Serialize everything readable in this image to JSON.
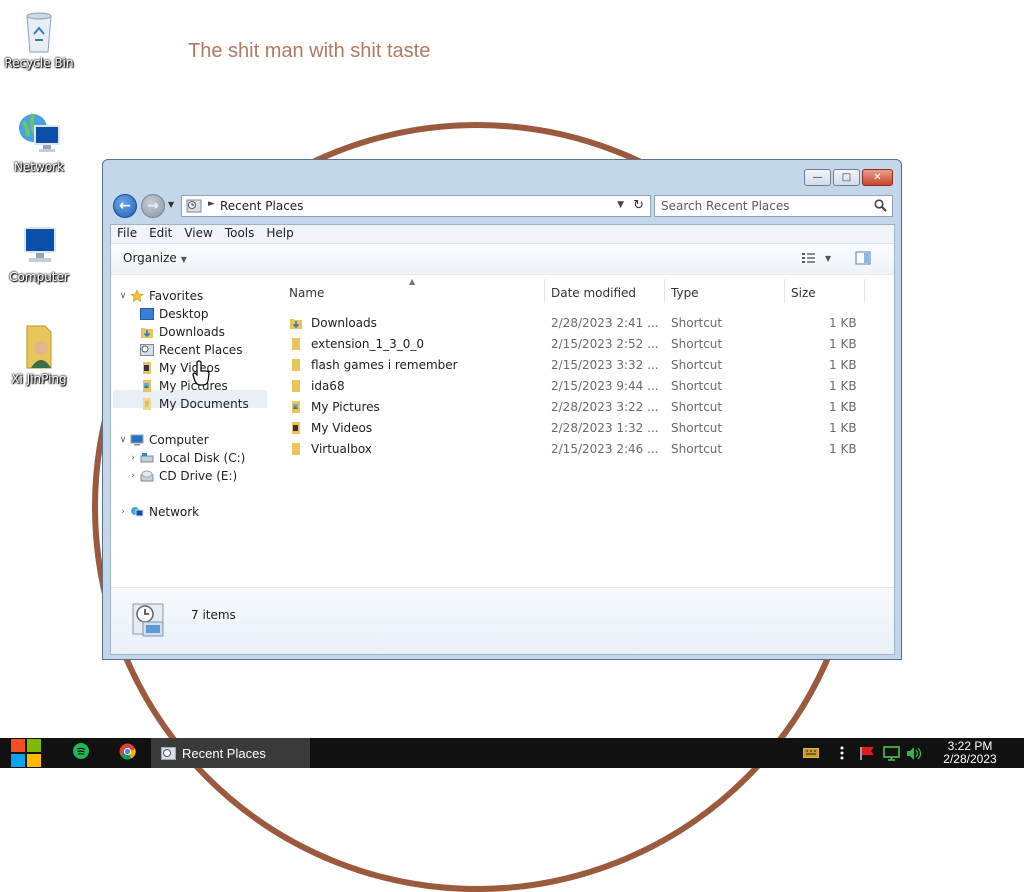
{
  "desktop": {
    "wallpaper_text": "The shit man with shit taste",
    "icons": [
      {
        "label": "Recycle Bin"
      },
      {
        "label": "Network"
      },
      {
        "label": "Computer"
      },
      {
        "label": "Xi JinPing"
      }
    ]
  },
  "window": {
    "address": {
      "path": "Recent Places"
    },
    "search": {
      "placeholder": "Search Recent Places"
    },
    "menu": [
      "File",
      "Edit",
      "View",
      "Tools",
      "Help"
    ],
    "organize_label": "Organize",
    "nav": {
      "favorites": "Favorites",
      "favorites_items": [
        "Desktop",
        "Downloads",
        "Recent Places",
        "My Videos",
        "My Pictures",
        "My Documents"
      ],
      "computer": "Computer",
      "computer_items": [
        "Local Disk (C:)",
        "CD Drive (E:)"
      ],
      "network": "Network"
    },
    "columns": [
      "Name",
      "Date modified",
      "Type",
      "Size"
    ],
    "files": [
      {
        "name": "Downloads",
        "date": "2/28/2023 2:41 ...",
        "type": "Shortcut",
        "size": "1 KB",
        "icon": "downloads-folder-icon"
      },
      {
        "name": "extension_1_3_0_0",
        "date": "2/15/2023 2:52 ...",
        "type": "Shortcut",
        "size": "1 KB",
        "icon": "folder-icon"
      },
      {
        "name": "flash games i remember",
        "date": "2/15/2023 3:32 ...",
        "type": "Shortcut",
        "size": "1 KB",
        "icon": "folder-icon"
      },
      {
        "name": "ida68",
        "date": "2/15/2023 9:44 ...",
        "type": "Shortcut",
        "size": "1 KB",
        "icon": "folder-icon"
      },
      {
        "name": "My Pictures",
        "date": "2/28/2023 3:22 ...",
        "type": "Shortcut",
        "size": "1 KB",
        "icon": "pictures-folder-icon"
      },
      {
        "name": "My Videos",
        "date": "2/28/2023 1:32 ...",
        "type": "Shortcut",
        "size": "1 KB",
        "icon": "videos-folder-icon"
      },
      {
        "name": "Virtualbox",
        "date": "2/15/2023 2:46 ...",
        "type": "Shortcut",
        "size": "1 KB",
        "icon": "folder-icon"
      }
    ],
    "status": {
      "item_count": "7 items"
    }
  },
  "taskbar": {
    "active_task": "Recent Places",
    "clock": {
      "time": "3:22 PM",
      "date": "2/28/2023"
    }
  },
  "colors": {
    "accent": "#1f5fb3",
    "wallpaper_ring": "#9b5a3e",
    "wallpaper_text": "#b07a62",
    "taskbar": "#111111"
  }
}
